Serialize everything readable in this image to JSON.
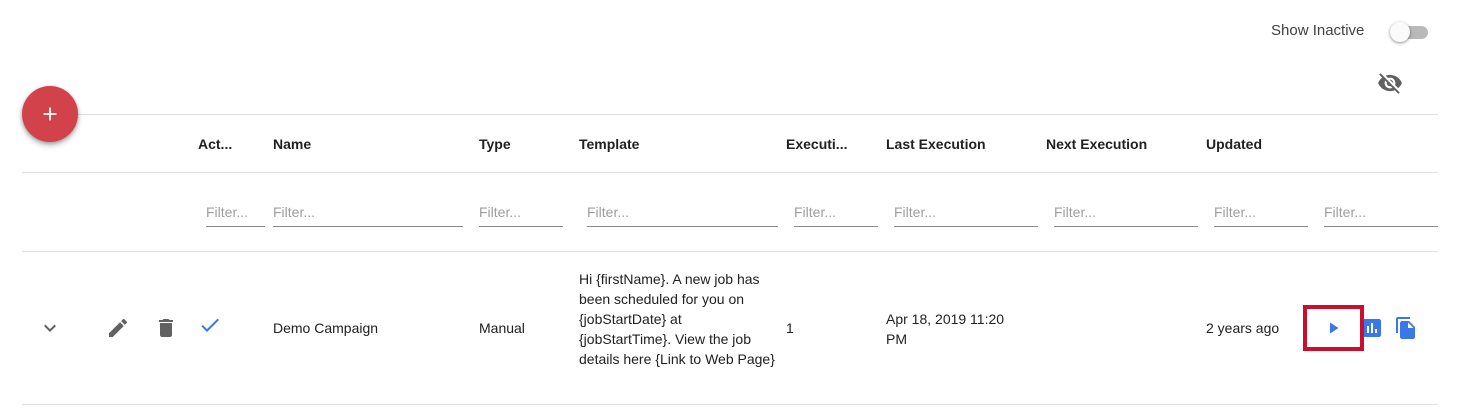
{
  "toolbar": {
    "show_inactive_label": "Show Inactive",
    "show_inactive_on": false
  },
  "table": {
    "columns": [
      "Act...",
      "Name",
      "Type",
      "Template",
      "Executi...",
      "Last Execution",
      "Next Execution",
      "Updated"
    ],
    "filter_placeholder": "Filter...",
    "rows": [
      {
        "active": true,
        "name": "Demo Campaign",
        "type": "Manual",
        "template": "Hi {firstName}. A new job has been scheduled for you on {jobStartDate} at {jobStartTime}. View the job details here {Link to Web Page}",
        "executions": "1",
        "last_execution": "Apr 18, 2019 11:20 PM",
        "next_execution": "",
        "updated": "2 years ago"
      }
    ]
  },
  "icons": {
    "fab": "add-icon",
    "visibility": "visibility-off-icon",
    "expand": "chevron-down-icon",
    "edit": "pencil-icon",
    "delete": "trash-icon",
    "active": "check-icon",
    "run": "play-icon",
    "stats": "bar-chart-icon",
    "copy": "copy-icon"
  },
  "colors": {
    "fab": "#d2424a",
    "accent_blue": "#3b78e7",
    "highlight": "#c8102e",
    "icon_gray": "#616161"
  }
}
